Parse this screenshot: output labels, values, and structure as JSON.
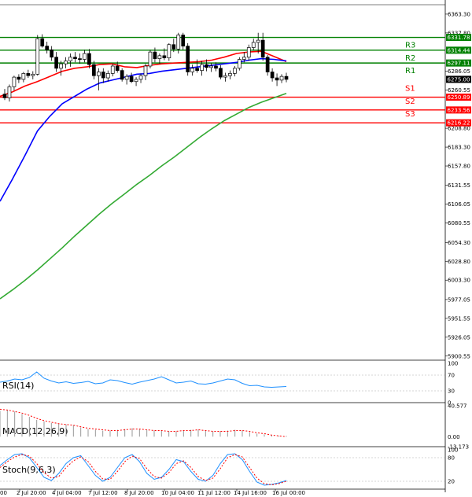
{
  "chart_data": {
    "type": "candlestick",
    "timeframe_ticks": [
      "2 Jul 20:00",
      "4 Jul 04:00",
      "7 Jul 12:00",
      "8 Jul 20:00",
      "10 Jul 04:00",
      "11 Jul 12:00",
      "14 Jul 16:00",
      "16 Jul 00:00"
    ],
    "first_tick_fragment": "00",
    "y_ticks": [
      "6363.30",
      "6337.80",
      "6286.05",
      "6260.55",
      "6208.80",
      "6183.30",
      "6157.80",
      "6131.55",
      "6106.05",
      "6080.55",
      "6054.30",
      "6028.80",
      "6003.30",
      "5977.05",
      "5951.55",
      "5926.05",
      "5900.55"
    ],
    "ylim": [
      5895,
      6376
    ],
    "current_price": "6275.00",
    "levels": [
      {
        "name": "R3",
        "value": 6331.78,
        "label": "6331.78",
        "color": "#008000"
      },
      {
        "name": "R2",
        "value": 6314.44,
        "label": "6314.44",
        "color": "#008000"
      },
      {
        "name": "R1",
        "value": 6297.11,
        "label": "6297.11",
        "color": "#008000"
      },
      {
        "name": "S1",
        "value": 6250.89,
        "label": "6250.89",
        "color": "#ff0000"
      },
      {
        "name": "S2",
        "value": 6233.56,
        "label": "6233.56",
        "color": "#ff0000"
      },
      {
        "name": "S3",
        "value": 6216.22,
        "label": "6216.22",
        "color": "#ff0000"
      }
    ],
    "candles": [
      [
        6255,
        6262,
        6247,
        6250
      ],
      [
        6250,
        6268,
        6245,
        6265
      ],
      [
        6265,
        6280,
        6260,
        6278
      ],
      [
        6278,
        6282,
        6270,
        6275
      ],
      [
        6275,
        6285,
        6271,
        6283
      ],
      [
        6283,
        6288,
        6277,
        6280
      ],
      [
        6280,
        6286,
        6275,
        6282
      ],
      [
        6282,
        6335,
        6280,
        6330
      ],
      [
        6330,
        6336,
        6318,
        6320
      ],
      [
        6320,
        6326,
        6310,
        6315
      ],
      [
        6315,
        6320,
        6300,
        6305
      ],
      [
        6305,
        6312,
        6285,
        6290
      ],
      [
        6290,
        6300,
        6280,
        6296
      ],
      [
        6296,
        6305,
        6290,
        6300
      ],
      [
        6300,
        6310,
        6292,
        6305
      ],
      [
        6305,
        6312,
        6298,
        6303
      ],
      [
        6303,
        6310,
        6296,
        6302
      ],
      [
        6302,
        6315,
        6298,
        6310
      ],
      [
        6310,
        6316,
        6290,
        6295
      ],
      [
        6295,
        6300,
        6275,
        6280
      ],
      [
        6280,
        6290,
        6260,
        6285
      ],
      [
        6285,
        6290,
        6270,
        6277
      ],
      [
        6277,
        6287,
        6272,
        6283
      ],
      [
        6283,
        6296,
        6279,
        6293
      ],
      [
        6293,
        6299,
        6284,
        6287
      ],
      [
        6287,
        6290,
        6272,
        6275
      ],
      [
        6275,
        6282,
        6268,
        6279
      ],
      [
        6279,
        6284,
        6270,
        6272
      ],
      [
        6272,
        6278,
        6266,
        6275
      ],
      [
        6275,
        6283,
        6270,
        6280
      ],
      [
        6280,
        6296,
        6274,
        6293
      ],
      [
        6293,
        6315,
        6290,
        6312
      ],
      [
        6312,
        6318,
        6298,
        6303
      ],
      [
        6303,
        6310,
        6296,
        6307
      ],
      [
        6307,
        6317,
        6301,
        6304
      ],
      [
        6304,
        6324,
        6300,
        6322
      ],
      [
        6322,
        6330,
        6312,
        6316
      ],
      [
        6316,
        6338,
        6310,
        6335
      ],
      [
        6335,
        6338,
        6315,
        6320
      ],
      [
        6320,
        6324,
        6280,
        6285
      ],
      [
        6285,
        6295,
        6280,
        6290
      ],
      [
        6290,
        6302,
        6284,
        6287
      ],
      [
        6287,
        6300,
        6280,
        6295
      ],
      [
        6295,
        6302,
        6286,
        6291
      ],
      [
        6291,
        6297,
        6285,
        6293
      ],
      [
        6293,
        6298,
        6286,
        6290
      ],
      [
        6290,
        6294,
        6275,
        6278
      ],
      [
        6278,
        6284,
        6272,
        6280
      ],
      [
        6280,
        6287,
        6275,
        6283
      ],
      [
        6283,
        6293,
        6279,
        6290
      ],
      [
        6290,
        6305,
        6287,
        6302
      ],
      [
        6302,
        6312,
        6298,
        6305
      ],
      [
        6305,
        6322,
        6300,
        6318
      ],
      [
        6318,
        6330,
        6314,
        6325
      ],
      [
        6325,
        6338,
        6310,
        6328
      ],
      [
        6328,
        6338,
        6300,
        6305
      ],
      [
        6305,
        6308,
        6280,
        6285
      ],
      [
        6285,
        6290,
        6272,
        6277
      ],
      [
        6277,
        6283,
        6266,
        6274
      ],
      [
        6274,
        6282,
        6270,
        6279
      ],
      [
        6279,
        6284,
        6271,
        6275
      ]
    ],
    "moving_averages": [
      {
        "color": "#ff0000",
        "values": [
          6252,
          6258,
          6266,
          6272,
          6279,
          6286,
          6290,
          6292,
          6295,
          6296,
          6292,
          6291,
          6294,
          6296,
          6297,
          6298,
          6299,
          6301,
          6305,
          6310,
          6312,
          6313,
          6306,
          6299
        ]
      },
      {
        "color": "#0000ff",
        "values": [
          6110,
          6140,
          6172,
          6205,
          6225,
          6242,
          6252,
          6262,
          6270,
          6274,
          6278,
          6282,
          6283,
          6286,
          6288,
          6290,
          6292,
          6294,
          6296,
          6298,
          6301,
          6303,
          6302,
          6300
        ]
      },
      {
        "color": "#33aa33",
        "values": [
          5978,
          5990,
          6003,
          6017,
          6032,
          6047,
          6063,
          6078,
          6093,
          6107,
          6120,
          6133,
          6145,
          6158,
          6170,
          6183,
          6196,
          6208,
          6219,
          6228,
          6237,
          6244,
          6250,
          6256
        ]
      }
    ],
    "rsi": {
      "label": "RSI(14)",
      "ticks": [
        "100",
        "70",
        "30",
        "0"
      ],
      "values": [
        52,
        55,
        60,
        58,
        64,
        78,
        62,
        55,
        50,
        53,
        49,
        51,
        54,
        48,
        50,
        58,
        56,
        51,
        47,
        52,
        56,
        60,
        66,
        58,
        50,
        52,
        55,
        48,
        47,
        50,
        55,
        60,
        58,
        49,
        43,
        44,
        40,
        39,
        40,
        41
      ]
    },
    "macd": {
      "label": "MACD(12,26,9)",
      "ticks": [
        "40.577",
        "0.00",
        "-13.173"
      ],
      "hist": [
        34,
        35,
        33,
        30,
        26,
        22,
        20,
        18,
        17,
        16,
        15,
        12,
        10,
        9,
        8,
        8,
        9,
        10,
        11,
        10,
        9,
        8,
        8,
        7,
        7,
        8,
        9,
        9,
        8,
        7,
        7,
        8,
        9,
        8,
        6,
        4,
        3,
        2,
        1,
        1
      ],
      "signal": [
        36,
        35,
        33,
        31,
        28,
        24,
        21,
        19,
        17,
        16,
        15,
        13,
        11,
        10,
        9,
        8,
        8,
        9,
        10,
        10,
        9,
        8,
        8,
        7,
        7,
        8,
        8,
        9,
        8,
        7,
        7,
        7,
        8,
        8,
        7,
        5,
        4,
        2,
        1,
        0
      ]
    },
    "stoch": {
      "label": "Stoch(9,6,3)",
      "ticks": [
        "100",
        "80",
        "20"
      ],
      "main": [
        60,
        75,
        88,
        90,
        80,
        55,
        30,
        22,
        40,
        65,
        80,
        85,
        60,
        35,
        20,
        30,
        55,
        80,
        88,
        70,
        40,
        25,
        30,
        50,
        75,
        70,
        45,
        25,
        20,
        35,
        65,
        88,
        90,
        75,
        45,
        18,
        10,
        12,
        16,
        22
      ],
      "signal": [
        55,
        70,
        82,
        88,
        84,
        65,
        42,
        28,
        32,
        55,
        72,
        82,
        70,
        45,
        26,
        25,
        45,
        70,
        84,
        78,
        52,
        32,
        28,
        42,
        65,
        72,
        55,
        32,
        22,
        28,
        52,
        80,
        88,
        82,
        55,
        28,
        14,
        11,
        14,
        20
      ]
    }
  }
}
